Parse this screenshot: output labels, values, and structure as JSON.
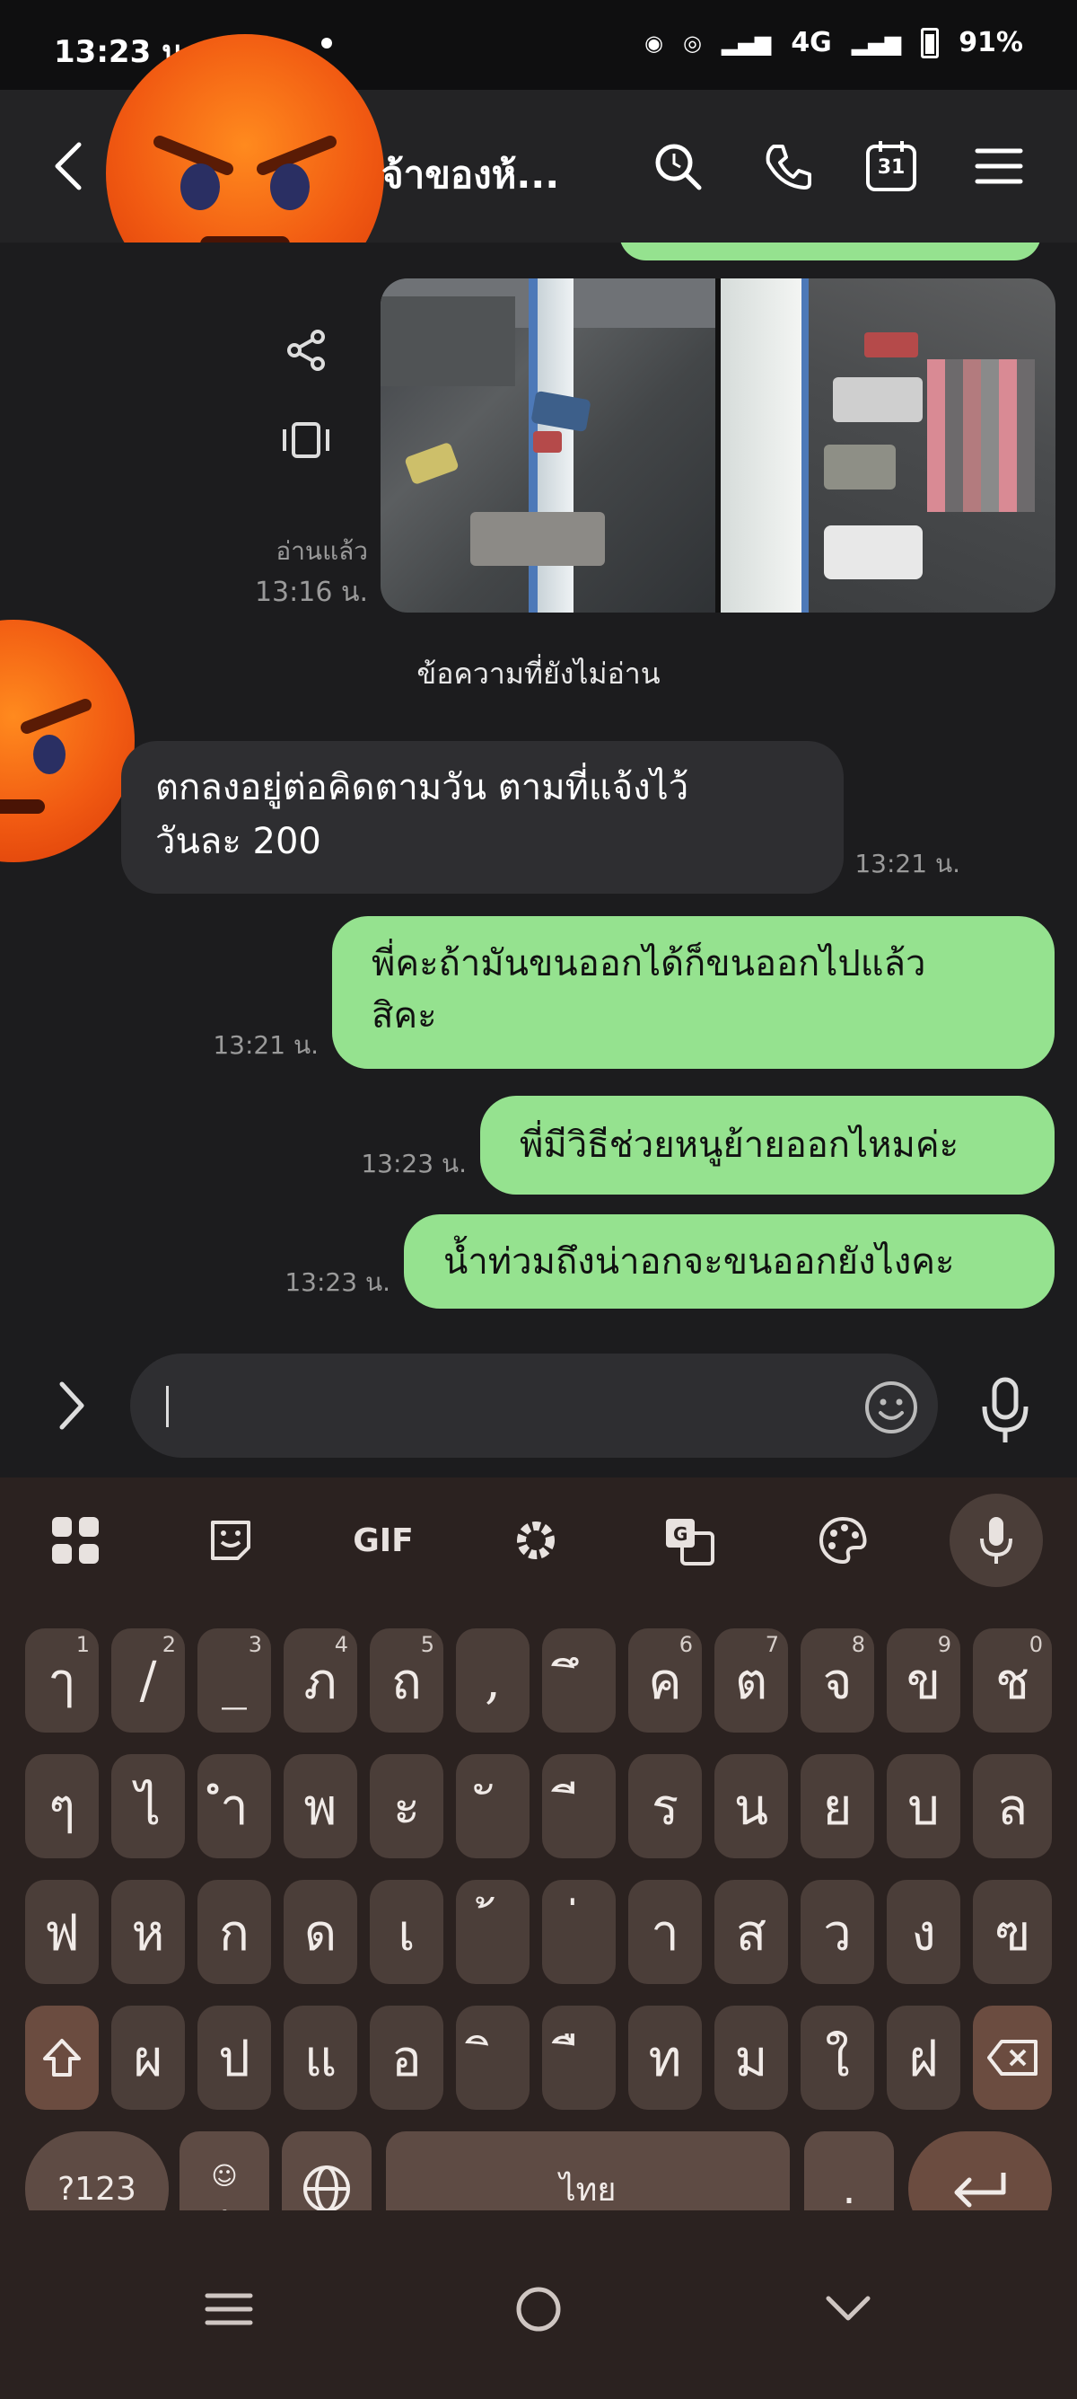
{
  "status_bar": {
    "time": "13:23 น.",
    "network": "4G",
    "battery": "91%"
  },
  "header": {
    "title": "จ้าของห้...",
    "icons": [
      "search-icon",
      "phone-icon",
      "calendar-icon",
      "menu-icon"
    ],
    "calendar_day": "31"
  },
  "photo_message": {
    "read_label": "อ่านแล้ว",
    "time": "13:16 น."
  },
  "unread_label": "ข้อความที่ยังไม่อ่าน",
  "messages": [
    {
      "side": "left",
      "lines": [
        "ตกลงอยู่ต่อคิดตามวัน ตามที่แจ้งไว้",
        "วันละ 200"
      ],
      "time": "13:21 น."
    },
    {
      "side": "right",
      "lines": [
        "พี่คะถ้ามันขนออกได้ก็ขนออกไปแล้ว",
        "สิคะ"
      ],
      "time": "13:21 น."
    },
    {
      "side": "right",
      "lines": [
        "พี่มีวิธีช่วยหนูย้ายออกไหมค่ะ"
      ],
      "time": "13:23 น."
    },
    {
      "side": "right",
      "lines": [
        "น้ำท่วมถึงน่าอกจะขนออกยังไงคะ"
      ],
      "time": "13:23 น."
    }
  ],
  "input": {
    "value": "",
    "placeholder": ""
  },
  "keyboard": {
    "toolbar": {
      "gif_label": "GIF"
    },
    "row1": [
      {
        "ch": "ๅ",
        "hint": "1"
      },
      {
        "ch": "/",
        "hint": "2"
      },
      {
        "ch": "_",
        "hint": "3"
      },
      {
        "ch": "ภ",
        "hint": "4"
      },
      {
        "ch": "ถ",
        "hint": "5"
      },
      {
        "ch": ",",
        "hint": ""
      },
      {
        "ch": "ึ",
        "hint": ""
      },
      {
        "ch": "ค",
        "hint": "6"
      },
      {
        "ch": "ต",
        "hint": "7"
      },
      {
        "ch": "จ",
        "hint": "8"
      },
      {
        "ch": "ข",
        "hint": "9"
      },
      {
        "ch": "ช",
        "hint": "0"
      }
    ],
    "row2": [
      "ๆ",
      "ไ",
      "ำ",
      "พ",
      "ะ",
      "ั",
      "ี",
      "ร",
      "น",
      "ย",
      "บ",
      "ล"
    ],
    "row3": [
      "ฟ",
      "ห",
      "ก",
      "ด",
      "เ",
      "้",
      "่",
      "า",
      "ส",
      "ว",
      "ง",
      "ฃ"
    ],
    "row4": [
      "ผ",
      "ป",
      "แ",
      "อ",
      "ิ",
      "ื",
      "ท",
      "ม",
      "ใ",
      "ฝ"
    ],
    "symbols_label": "?123",
    "space_label": "ไทย",
    "period_label": ".",
    "emoji_comma": ","
  },
  "colors": {
    "green_bubble": "#95e28f",
    "grey_bubble": "#2e2e31",
    "keyboard_bg": "#2b2220",
    "key_bg": "#4b3e39"
  }
}
